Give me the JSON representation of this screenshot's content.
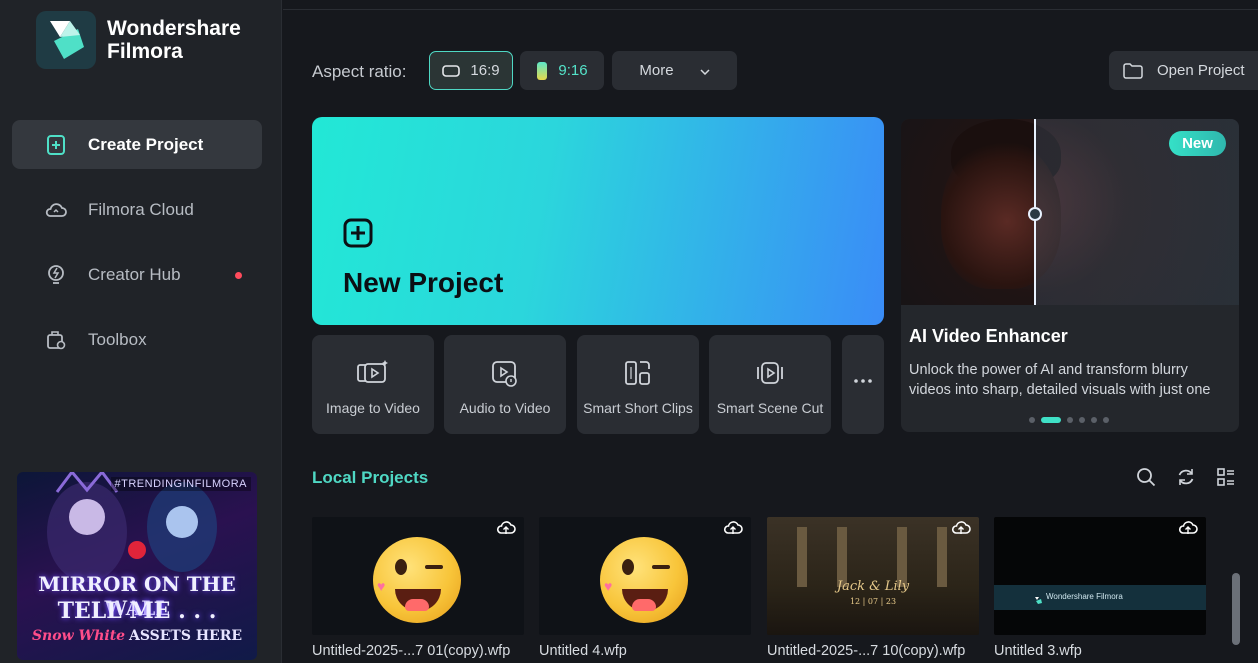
{
  "app": {
    "name_line1": "Wondershare",
    "name_line2": "Filmora"
  },
  "sidebar": {
    "items": [
      {
        "label": "Create Project",
        "icon": "plus-square-icon",
        "active": true
      },
      {
        "label": "Filmora Cloud",
        "icon": "cloud-icon",
        "active": false
      },
      {
        "label": "Creator Hub",
        "icon": "lightbulb-icon",
        "active": false,
        "badge": true
      },
      {
        "label": "Toolbox",
        "icon": "toolbox-icon",
        "active": false
      }
    ],
    "promo": {
      "tag": "#TRENDINGINFILMORA",
      "line1": "MIRROR ON THE WALL",
      "line2": "TELL ME . . .",
      "line3a": "Snow White",
      "line3b": "ASSETS HERE"
    }
  },
  "toolbar": {
    "aspect_label": "Aspect ratio:",
    "ratio_16_9": "16:9",
    "ratio_9_16": "9:16",
    "more": "More",
    "open_project": "Open Project"
  },
  "new_project": {
    "label": "New Project"
  },
  "tools": [
    {
      "label": "Image to Video",
      "icon": "image-to-video-icon"
    },
    {
      "label": "Audio to Video",
      "icon": "audio-to-video-icon"
    },
    {
      "label": "Smart Short Clips",
      "icon": "smart-short-clips-icon"
    },
    {
      "label": "Smart Scene Cut",
      "icon": "smart-scene-cut-icon"
    }
  ],
  "ai_card": {
    "badge": "New",
    "title": "AI Video Enhancer",
    "description": "Unlock the power of AI and transform blurry videos into sharp, detailed visuals with just one click.",
    "slides": 6,
    "active_slide": 2
  },
  "local_projects": {
    "title": "Local Projects",
    "items": [
      {
        "name": "Untitled-2025-...7 01(copy).wfp",
        "thumb": "emoji"
      },
      {
        "name": "Untitled 4.wfp",
        "thumb": "emoji"
      },
      {
        "name": "Untitled-2025-...7 10(copy).wfp",
        "thumb": "wedding",
        "thumb_text1": "Jack & Lily",
        "thumb_text2": "12 | 07 | 23"
      },
      {
        "name": "Untitled 3.wfp",
        "thumb": "banner",
        "thumb_text": "Wondershare Filmora"
      }
    ]
  },
  "colors": {
    "accent": "#4fd8c4",
    "sidebar_bg": "#202328",
    "main_bg": "#16181d",
    "card_bg": "#2a2d33"
  }
}
